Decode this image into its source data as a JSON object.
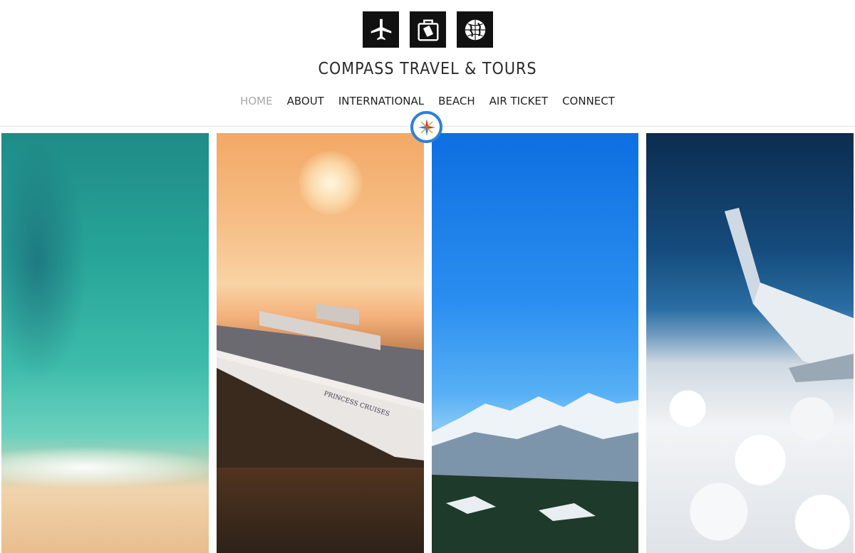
{
  "logo_icons": [
    "airplane-icon",
    "luggage-icon",
    "globe-icon"
  ],
  "brand": {
    "title": "COMPASS TRAVEL & TOURS"
  },
  "nav": {
    "items": [
      {
        "label": "HOME",
        "active": true
      },
      {
        "label": "ABOUT",
        "active": false
      },
      {
        "label": "INTERNATIONAL",
        "active": false
      },
      {
        "label": "BEACH",
        "active": false
      },
      {
        "label": "AIR TICKET",
        "active": false
      },
      {
        "label": "CONNECT",
        "active": false
      }
    ]
  },
  "compass_badge": {
    "icon": "compass-icon",
    "ring_color": "#2f7fd8"
  },
  "gallery": {
    "panels": [
      {
        "name": "beach-photo",
        "subject": "aerial turquoise ocean and sandy beach"
      },
      {
        "name": "cruise-photo",
        "subject": "cruise ship at sunset",
        "ship_text": "PRINCESS CRUISES"
      },
      {
        "name": "mountain-photo",
        "subject": "snowy mountains under blue sky"
      },
      {
        "name": "plane-photo",
        "subject": "airplane wing above clouds"
      }
    ]
  },
  "colors": {
    "nav_active": "#a8a8a8",
    "nav_default": "#222222",
    "logo_tile": "#111111"
  }
}
